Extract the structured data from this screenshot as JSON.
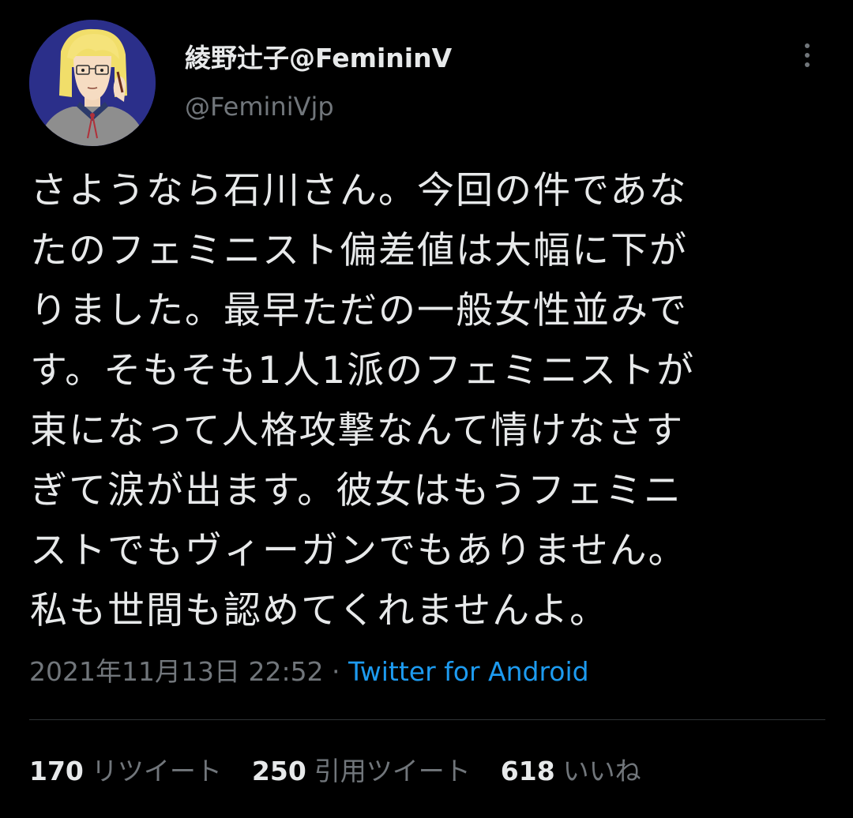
{
  "profile": {
    "display_name": "綾野辻子@FemininV",
    "handle": "@FeminiVjp",
    "avatar_icon": "avatar-illustration-icon"
  },
  "tweet": {
    "lines": [
      "さようなら石川さん。今回の件であな",
      "たのフェミニスト偏差値は大幅に下が",
      "りました。最早ただの一般女性並みで",
      "す。そもそも1人1派のフェミニストが",
      "束になって人格攻撃なんて情けなさす",
      "ぎて涙が出ます。彼女はもうフェミニ",
      "ストでもヴィーガンでもありません。",
      "私も世間も認めてくれませんよ。"
    ],
    "timestamp": "2021年11月13日 22:52",
    "separator": " · ",
    "source": "Twitter for Android"
  },
  "stats": {
    "retweets": {
      "count": "170",
      "label": "リツイート"
    },
    "quotes": {
      "count": "250",
      "label": "引用ツイート"
    },
    "likes": {
      "count": "618",
      "label": "いいね"
    }
  },
  "colors": {
    "background": "#000000",
    "text_primary": "#e7e9ea",
    "text_secondary": "#71767b",
    "link": "#1d9bf0",
    "divider": "#2f3336"
  }
}
